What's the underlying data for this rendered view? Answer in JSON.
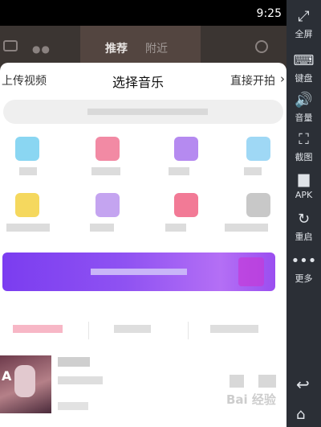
{
  "status": {
    "time": "9:25"
  },
  "app_header": {
    "tab_recommend": "推荐",
    "tab_nearby": "附近"
  },
  "sheet": {
    "upload": "上传视频",
    "title": "选择音乐",
    "shoot": "直接开拍",
    "shoot_chevron": "›"
  },
  "categories": [
    {
      "color": "#8ad6f2"
    },
    {
      "color": "#f28aa4"
    },
    {
      "color": "#b58af0"
    },
    {
      "color": "#9fd8f5"
    },
    {
      "color": "#f5d85e"
    },
    {
      "color": "#c4a4f0"
    },
    {
      "color": "#f27a96"
    },
    {
      "color": "#c8c8c8"
    }
  ],
  "banner": {
    "accent": "#7b3df0"
  },
  "subtabs": {
    "active_color": "#f7b7c6"
  },
  "song": {
    "cover_letter": "A"
  },
  "toolbar": {
    "fullscreen": "全屏",
    "keyboard": "键盘",
    "volume": "音量",
    "screenshot": "截图",
    "apk": "APK",
    "restart": "重启",
    "more": "更多"
  },
  "watermark": "Bai 经验"
}
